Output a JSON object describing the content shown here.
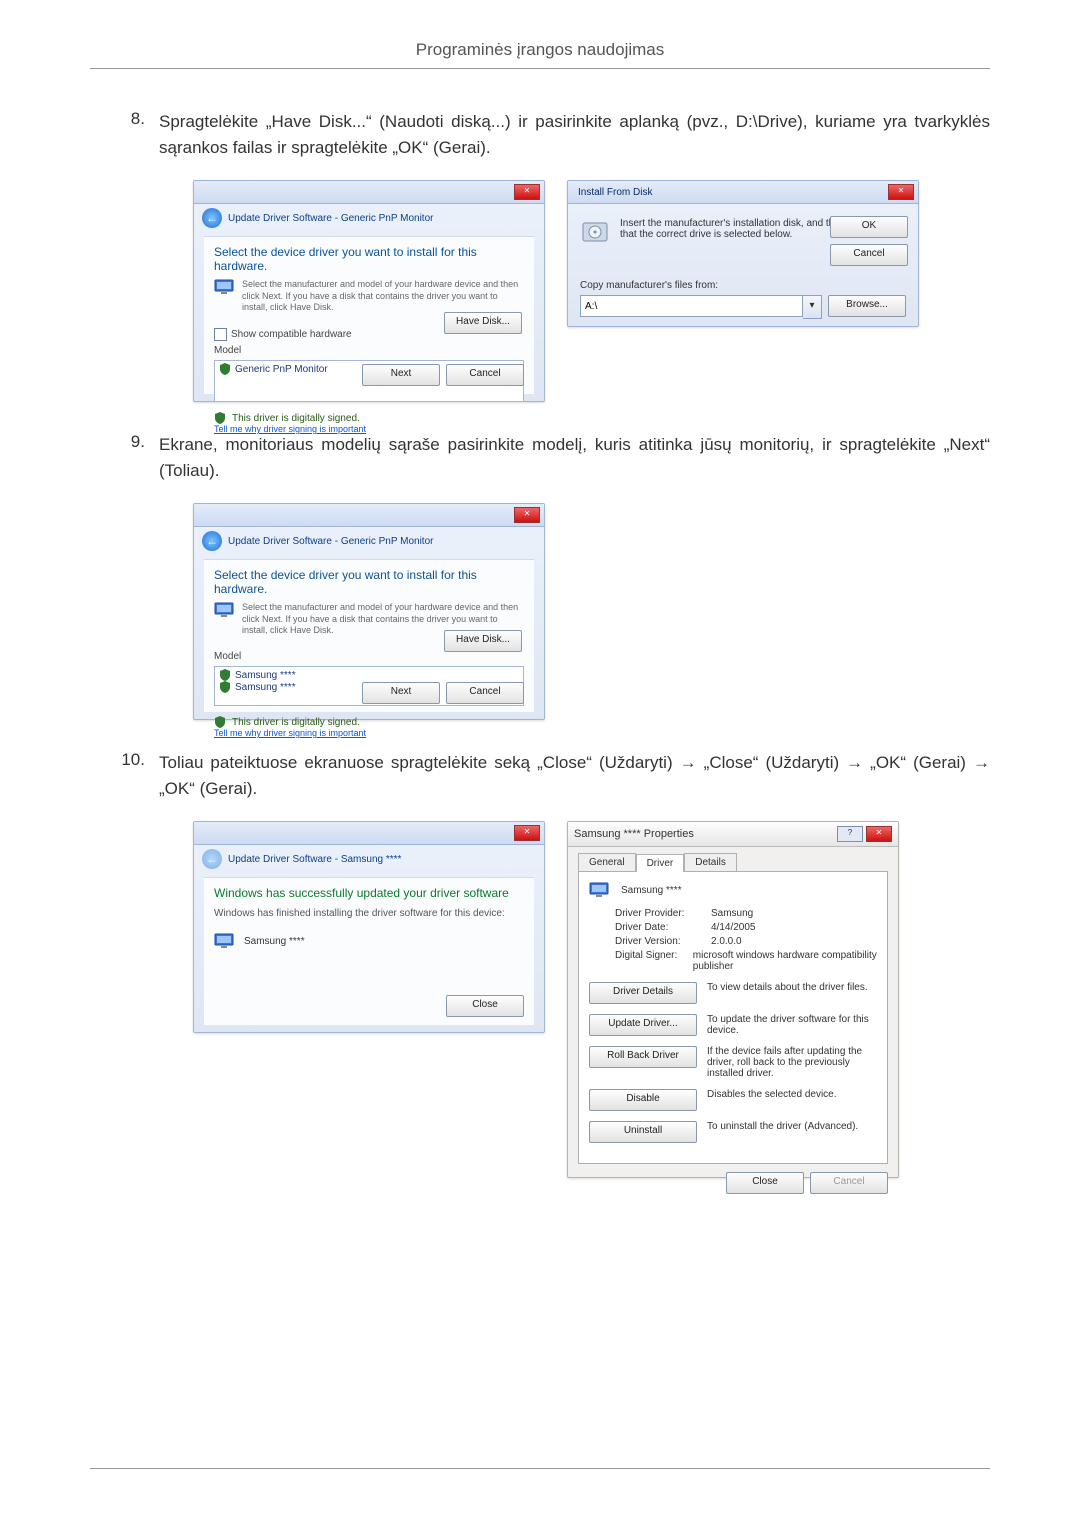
{
  "header": {
    "title": "Programinės įrangos naudojimas"
  },
  "steps": {
    "s8": {
      "num": "8",
      "text": "Spragtelėkite „Have Disk...“ (Naudoti diską...) ir pasirinkite aplanką (pvz., D:\\Drive), kuriame yra tvarkyklės sąrankos failas ir spragtelėkite „OK“ (Gerai)."
    },
    "s9": {
      "num": "9",
      "text": "Ekrane, monitoriaus modelių sąraše pasirinkite modelį, kuris atitinka jūsų monitorių, ir spragtelėkite „Next“ (Toliau)."
    },
    "s10": {
      "num": "10",
      "text": "Toliau pateiktuose ekranuose spragtelėkite seką „Close“ (Uždaryti) → „Close“ (Uždaryti) → „OK“ (Gerai) → „OK“ (Gerai)."
    }
  },
  "wiz_a": {
    "crumb": "Update Driver Software - Generic PnP Monitor",
    "headline": "Select the device driver you want to install for this hardware.",
    "sub": "Select the manufacturer and model of your hardware device and then click Next. If you have a disk that contains the driver you want to install, click Have Disk.",
    "show_compat": "Show compatible hardware",
    "model_hdr": "Model",
    "model_item": "Generic PnP Monitor",
    "signed": "This driver is digitally signed.",
    "why_link": "Tell me why driver signing is important",
    "have_disk": "Have Disk...",
    "next": "Next",
    "cancel": "Cancel"
  },
  "ifd": {
    "title": "Install From Disk",
    "msg": "Insert the manufacturer's installation disk, and then make sure that the correct drive is selected below.",
    "ok": "OK",
    "cancel": "Cancel",
    "copy_label": "Copy manufacturer's files from:",
    "path": "A:\\",
    "browse": "Browse..."
  },
  "wiz_b": {
    "crumb": "Update Driver Software - Generic PnP Monitor",
    "headline": "Select the device driver you want to install for this hardware.",
    "sub": "Select the manufacturer and model of your hardware device and then click Next. If you have a disk that contains the driver you want to install, click Have Disk.",
    "model_hdr": "Model",
    "model1": "Samsung ****",
    "model2": "Samsung ****",
    "signed": "This driver is digitally signed.",
    "why_link": "Tell me why driver signing is important",
    "have_disk": "Have Disk...",
    "next": "Next",
    "cancel": "Cancel"
  },
  "wiz_c": {
    "crumb": "Update Driver Software - Samsung ****",
    "headline": "Windows has successfully updated your driver software",
    "sub": "Windows has finished installing the driver software for this device:",
    "device": "Samsung ****",
    "close": "Close"
  },
  "prop": {
    "title": "Samsung **** Properties",
    "tab_general": "General",
    "tab_driver": "Driver",
    "tab_details": "Details",
    "device": "Samsung ****",
    "provider_k": "Driver Provider:",
    "provider_v": "Samsung",
    "date_k": "Driver Date:",
    "date_v": "4/14/2005",
    "version_k": "Driver Version:",
    "version_v": "2.0.0.0",
    "signer_k": "Digital Signer:",
    "signer_v": "microsoft windows hardware compatibility publisher",
    "btn_details": "Driver Details",
    "btn_details_txt": "To view details about the driver files.",
    "btn_update": "Update Driver...",
    "btn_update_txt": "To update the driver software for this device.",
    "btn_roll": "Roll Back Driver",
    "btn_roll_txt": "If the device fails after updating the driver, roll back to the previously installed driver.",
    "btn_disable": "Disable",
    "btn_disable_txt": "Disables the selected device.",
    "btn_uninstall": "Uninstall",
    "btn_uninstall_txt": "To uninstall the driver (Advanced).",
    "close": "Close",
    "cancel": "Cancel"
  }
}
